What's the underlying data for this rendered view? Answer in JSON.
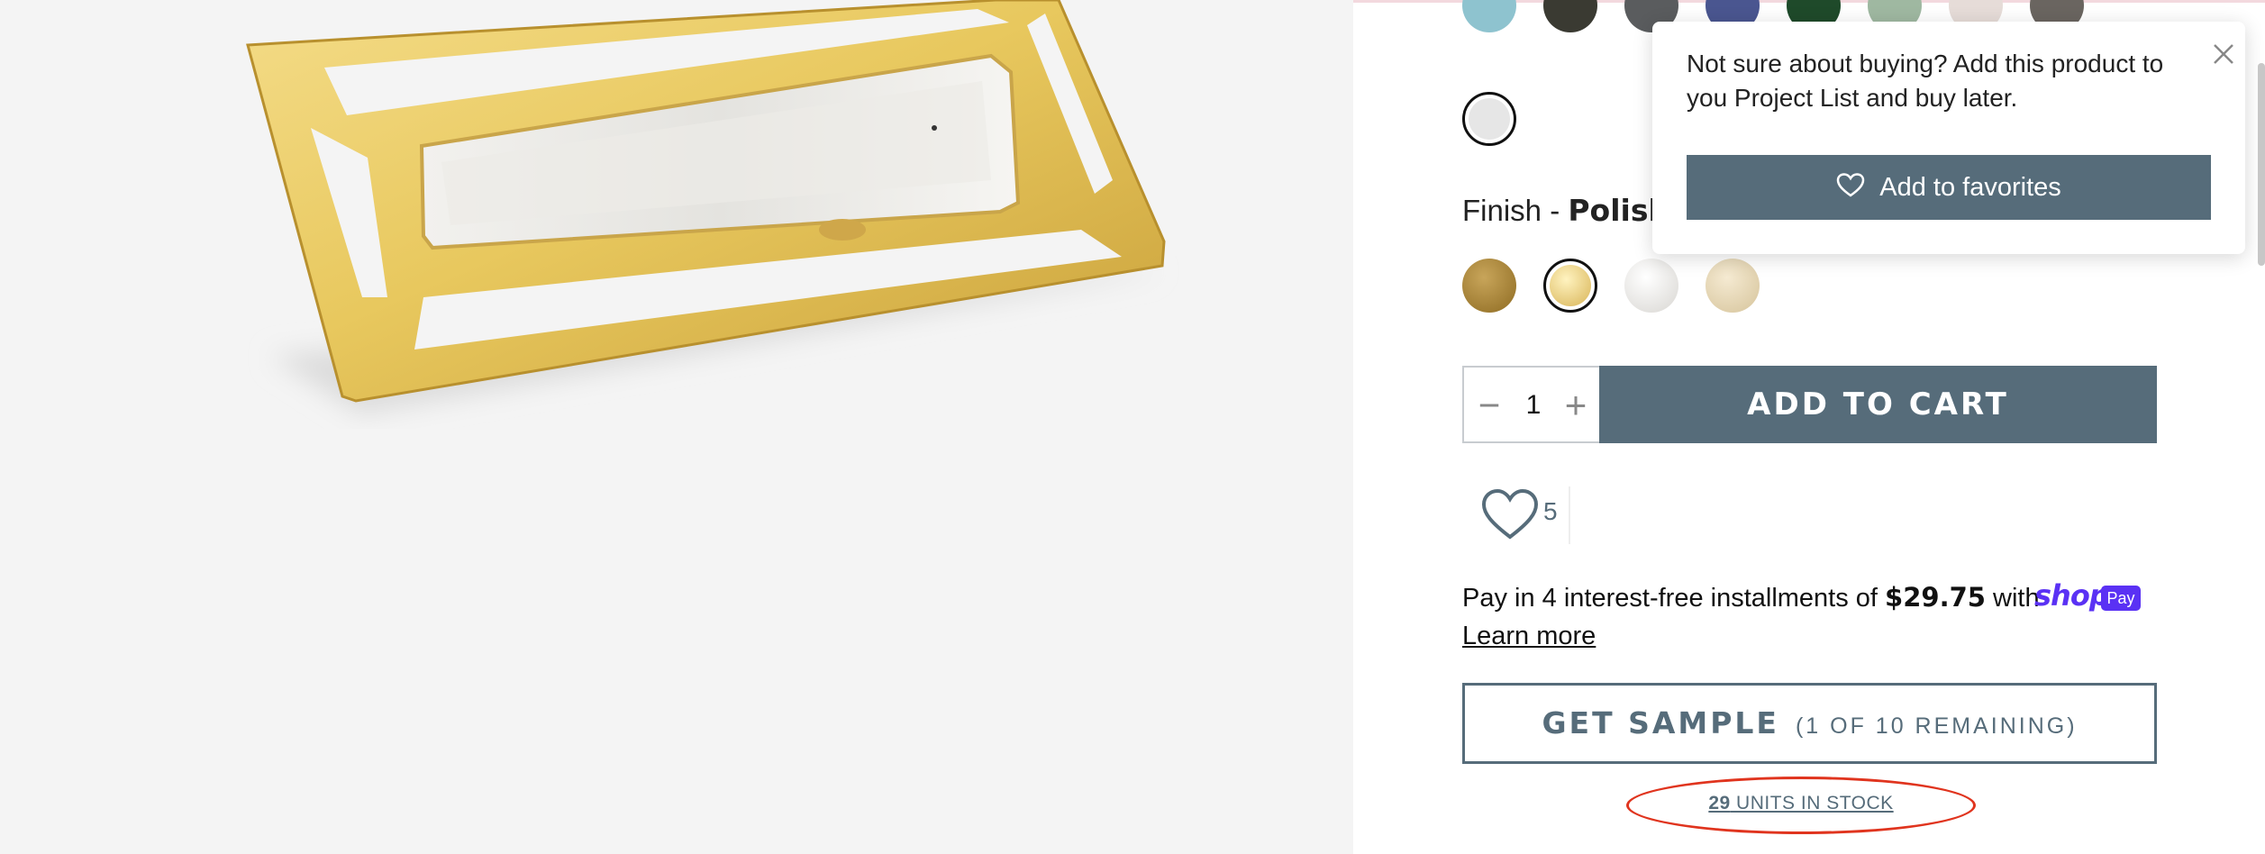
{
  "finish": {
    "label": "Finish - ",
    "value": "Polish"
  },
  "quantity": {
    "minus": "−",
    "value": "1",
    "plus": "+"
  },
  "add_to_cart": "ADD TO CART",
  "favorites": {
    "count": "5"
  },
  "shop_pay": {
    "text_before": "Pay in 4 interest-free installments of ",
    "amount": "$29.75",
    "text_after": " with ",
    "brand": "shop",
    "badge": "Pay",
    "learn_more": "Learn more"
  },
  "sample": {
    "label": "GET SAMPLE",
    "remaining": "(1 OF 10 REMAINING)"
  },
  "stock": {
    "count": "29",
    "label": " UNITS IN STOCK"
  },
  "popover": {
    "message": "Not sure about buying? Add this product to you Project List and buy later.",
    "button": "Add to favorites"
  },
  "colors": {
    "accent": "#566c7a",
    "annotation": "#e0341e",
    "shop_pay": "#5a31f4"
  },
  "icons": [
    "heart-icon",
    "close-icon",
    "minus-icon",
    "plus-icon"
  ]
}
